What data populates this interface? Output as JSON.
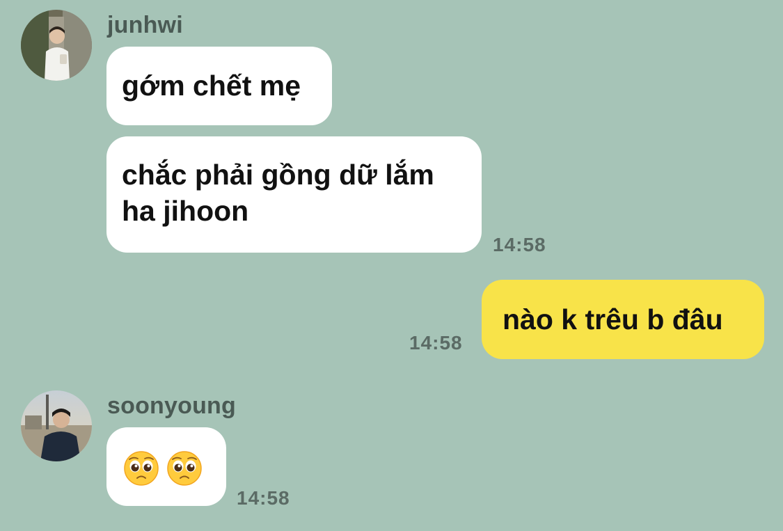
{
  "colors": {
    "background": "#a6c4b7",
    "incoming_bubble": "#ffffff",
    "outgoing_bubble": "#f8e349",
    "sender_name": "#4a5a54",
    "timestamp": "#5b6b65"
  },
  "messages": [
    {
      "sender": "junhwi",
      "avatar_icon": "avatar-photo-junhwi",
      "bubbles": [
        {
          "text": "gớm chết mẹ"
        },
        {
          "text": "chắc phải gồng dữ lắm ha jihoon",
          "time": "14:58"
        }
      ]
    },
    {
      "sender": "me",
      "bubbles": [
        {
          "text": "nào k trêu b đâu",
          "time": "14:58"
        }
      ]
    },
    {
      "sender": "soonyoung",
      "avatar_icon": "avatar-photo-soonyoung",
      "bubbles": [
        {
          "emoji": [
            "pleading-face-emoji",
            "pleading-face-emoji"
          ],
          "time": "14:58"
        }
      ]
    }
  ]
}
